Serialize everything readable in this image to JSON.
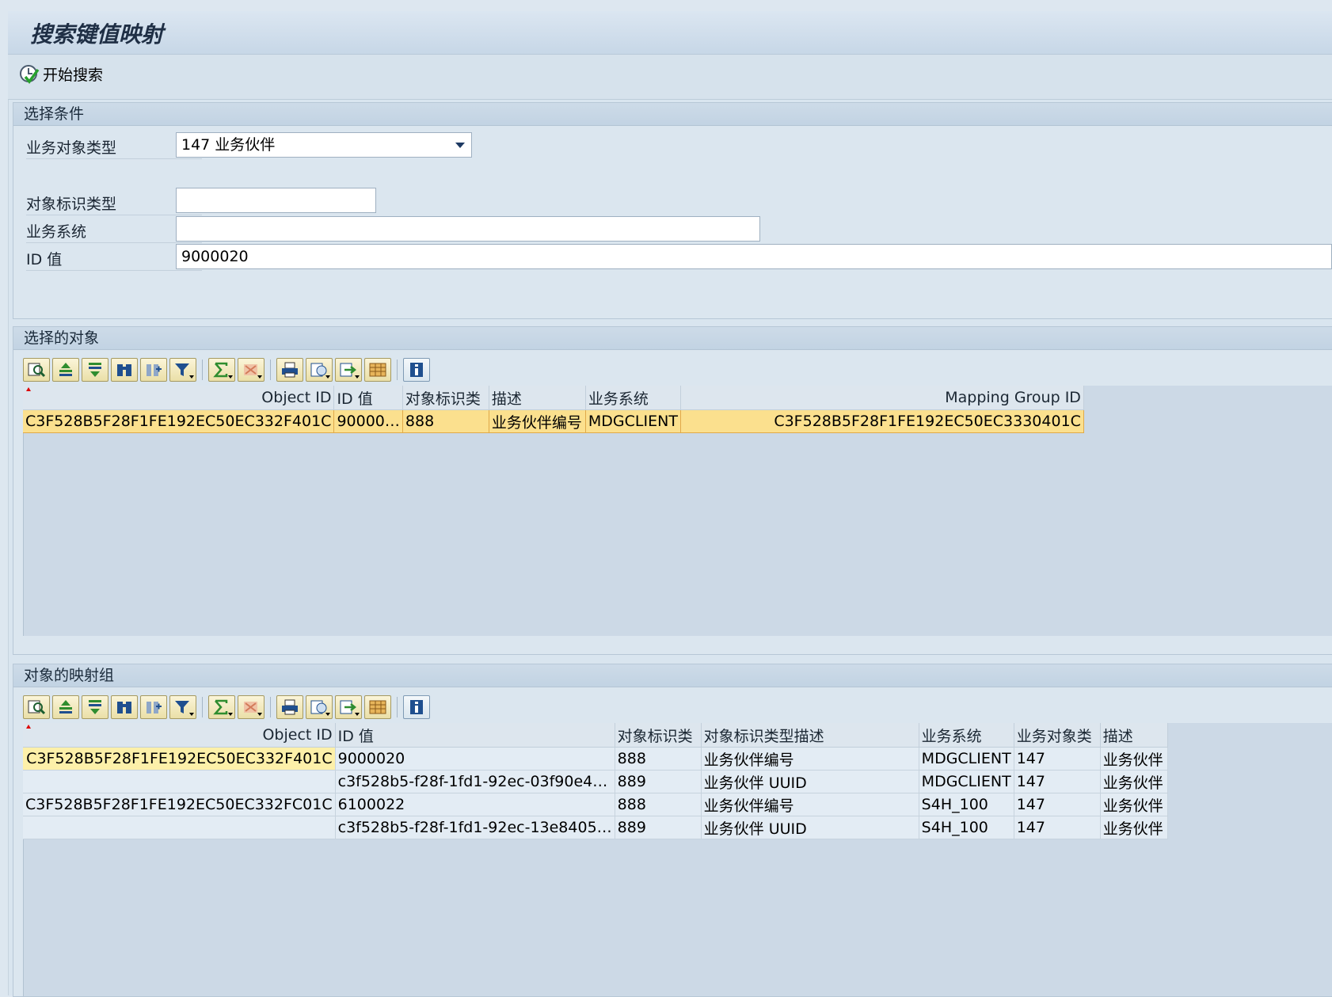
{
  "window": {
    "title": "搜索键值映射"
  },
  "toolbar": {
    "start_search_label": "开始搜索"
  },
  "selection": {
    "header": "选择条件",
    "fields": {
      "bo_type": {
        "label": "业务对象类型",
        "value": "147 业务伙伴"
      },
      "id_type": {
        "label": "对象标识类型",
        "value": ""
      },
      "system": {
        "label": "业务系统",
        "value": ""
      },
      "id_value": {
        "label": "ID 值",
        "value": "9000020"
      }
    }
  },
  "selected_objects": {
    "header": "选择的对象",
    "columns": [
      "Object ID",
      "ID 值",
      "对象标识类",
      "描述",
      "业务系统",
      "Mapping Group ID"
    ],
    "rows": [
      [
        "C3F528B5F28F1FE192EC50EC332F401C",
        "90000…",
        "888",
        "业务伙伴编号",
        "MDGCLIENT",
        "C3F528B5F28F1FE192EC50EC3330401C"
      ]
    ]
  },
  "mapping_group": {
    "header": "对象的映射组",
    "columns": [
      "Object ID",
      "ID 值",
      "对象标识类",
      "对象标识类型描述",
      "业务系统",
      "业务对象类",
      "描述"
    ],
    "rows": [
      [
        "C3F528B5F28F1FE192EC50EC332F401C",
        "9000020",
        "888",
        "业务伙伴编号",
        "MDGCLIENT",
        "147",
        "业务伙伴"
      ],
      [
        "",
        "c3f528b5-f28f-1fd1-92ec-03f90e4…",
        "889",
        "业务伙伴 UUID",
        "MDGCLIENT",
        "147",
        "业务伙伴"
      ],
      [
        "C3F528B5F28F1FE192EC50EC332FC01C",
        "6100022",
        "888",
        "业务伙伴编号",
        "S4H_100",
        "147",
        "业务伙伴"
      ],
      [
        "",
        "c3f528b5-f28f-1fd1-92ec-13e8405…",
        "889",
        "业务伙伴 UUID",
        "S4H_100",
        "147",
        "业务伙伴"
      ]
    ]
  },
  "alv_toolbar_icons": [
    "details-icon",
    "sort-ascending-icon",
    "sort-descending-icon",
    "find-icon",
    "find-next-icon",
    "filter-icon",
    "sum-icon",
    "subtotal-icon",
    "print-icon",
    "views-icon",
    "export-icon",
    "layout-icon",
    "info-icon"
  ]
}
